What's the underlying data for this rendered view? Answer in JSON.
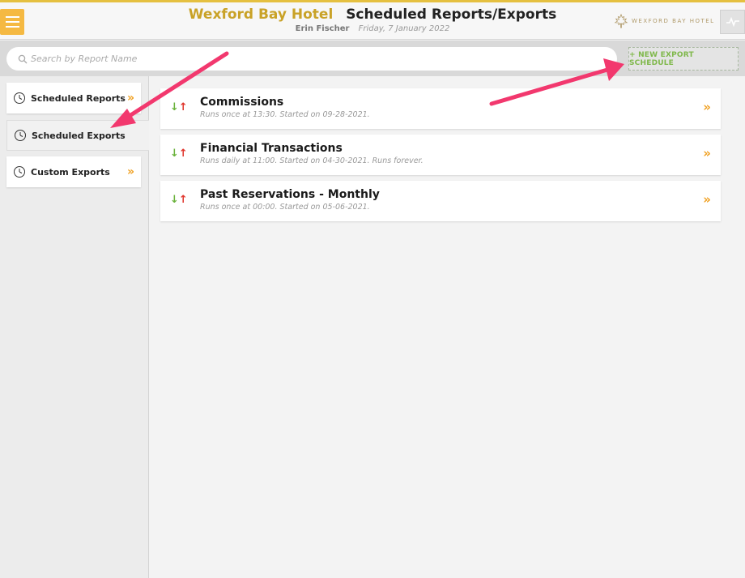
{
  "header": {
    "hotel_name": "Wexford Bay Hotel",
    "page_title": "Scheduled Reports/Exports",
    "user": "Erin Fischer",
    "date": "Friday, 7 January 2022",
    "brand_text": "WEXFORD BAY HOTEL",
    "accent_color": "#e5c040"
  },
  "search": {
    "placeholder": "Search by Report Name",
    "new_button_label": "+ NEW EXPORT SCHEDULE"
  },
  "sidebar": {
    "items": [
      {
        "label": "Scheduled Reports",
        "active": false
      },
      {
        "label": "Scheduled Exports",
        "active": true
      },
      {
        "label": "Custom Exports",
        "active": false
      }
    ]
  },
  "exports": [
    {
      "name": "Commissions",
      "description": "Runs once at 13:30. Started on 09-28-2021."
    },
    {
      "name": "Financial Transactions",
      "description": "Runs daily at 11:00. Started on 04-30-2021. Runs forever."
    },
    {
      "name": "Past Reservations - Monthly",
      "description": "Runs once at 00:00. Started on 05-06-2021."
    }
  ],
  "icons": {
    "menu": "hamburger-icon",
    "search": "search-icon",
    "clock": "clock-icon",
    "chevron": "double-chevron-right-icon",
    "arrows": "down-up-arrows-icon",
    "activity": "activity-icon",
    "logo": "maple-leaf-icon"
  },
  "arrow_color": "#f2386e"
}
